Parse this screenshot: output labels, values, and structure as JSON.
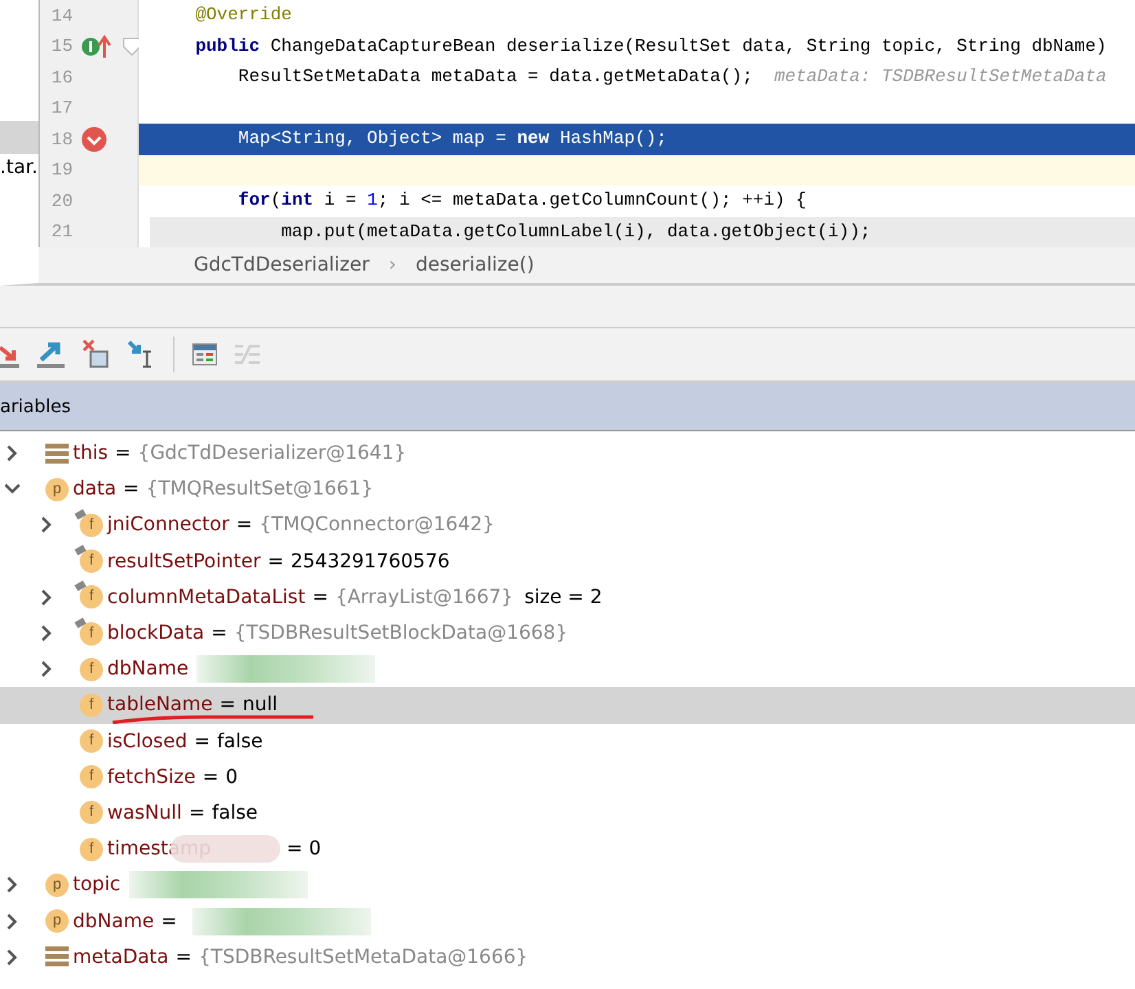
{
  "project_fragment": {
    "text": ".tar."
  },
  "code_lines": [
    {
      "number": "14",
      "breakpoint": false,
      "override": false,
      "execution": false,
      "caret": false,
      "folded": false,
      "tokens": [
        {
          "kind": "annotation",
          "text": "    @Override"
        }
      ]
    },
    {
      "number": "15",
      "breakpoint": false,
      "override": true,
      "execution": false,
      "caret": false,
      "folded": false,
      "tokens": [
        {
          "kind": "keyword",
          "text": "    public"
        },
        {
          "kind": "plain",
          "text": " ChangeDataCaptureBean deserialize(ResultSet data, String topic, String dbName)"
        }
      ]
    },
    {
      "number": "16",
      "breakpoint": false,
      "override": false,
      "execution": false,
      "caret": false,
      "folded": false,
      "tokens": [
        {
          "kind": "plain",
          "text": "        ResultSetMetaData metaData = data.getMetaData();"
        },
        {
          "kind": "hint",
          "text": "  metaData: TSDBResultSetMetaData"
        }
      ]
    },
    {
      "number": "17",
      "breakpoint": false,
      "override": false,
      "execution": false,
      "caret": false,
      "folded": false
    },
    {
      "number": "18",
      "breakpoint": true,
      "override": false,
      "execution": true,
      "caret": false,
      "folded": false,
      "tokens": [
        {
          "kind": "plain",
          "text": "        Map<String, Object> map = "
        },
        {
          "kind": "keyword",
          "text": "new"
        },
        {
          "kind": "plain",
          "text": " HashMap();"
        }
      ]
    },
    {
      "number": "19",
      "breakpoint": false,
      "override": false,
      "execution": false,
      "caret": true,
      "folded": false
    },
    {
      "number": "20",
      "breakpoint": false,
      "override": false,
      "execution": false,
      "caret": false,
      "folded": false,
      "tokens": [
        {
          "kind": "keyword",
          "text": "        for"
        },
        {
          "kind": "plain",
          "text": "("
        },
        {
          "kind": "keyword",
          "text": "int"
        },
        {
          "kind": "plain",
          "text": " i = "
        },
        {
          "kind": "number",
          "text": "1"
        },
        {
          "kind": "plain",
          "text": "; i <= metaData.getColumnCount(); ++i) {"
        }
      ]
    },
    {
      "number": "21",
      "breakpoint": false,
      "override": false,
      "execution": false,
      "caret": false,
      "folded": true,
      "tokens": [
        {
          "kind": "plain",
          "text": "            map.put(metaData.getColumnLabel(i), data.getObject(i));"
        }
      ]
    }
  ],
  "breadcrumbs": [
    "GdcTdDeserializer",
    "deserialize()"
  ],
  "breadcrumb_separator": "›",
  "toolbar_buttons": [
    {
      "kind": "step-out",
      "disabled": false
    },
    {
      "kind": "run-to-cursor",
      "disabled": false
    },
    {
      "kind": "drop-frame",
      "disabled": false
    },
    {
      "kind": "evaluate",
      "disabled": false
    },
    {
      "kind": "table",
      "disabled": false
    },
    {
      "kind": "trace",
      "disabled": true
    }
  ],
  "panel_title": "ariables",
  "variables": [
    {
      "name": "this",
      "kind": "object",
      "expanded": false,
      "selected": false,
      "eq": "=",
      "value": "{GdcTdDeserializer@1641}",
      "reference": true
    },
    {
      "name": "data",
      "kind": "param",
      "icon_letter": "p",
      "expanded": true,
      "selected": false,
      "eq": "=",
      "value": "{TMQResultSet@1661}",
      "reference": true,
      "children": [
        {
          "name": "jniConnector",
          "kind": "field",
          "icon_letter": "f",
          "overlay": true,
          "expandable": true,
          "selected": false,
          "eq": "=",
          "value": "{TMQConnector@1642}",
          "reference": true
        },
        {
          "name": "resultSetPointer",
          "kind": "field",
          "icon_letter": "f",
          "overlay": true,
          "expandable": false,
          "selected": false,
          "eq": "=",
          "value": "2543291760576",
          "reference": false
        },
        {
          "name": "columnMetaDataList",
          "kind": "field",
          "icon_letter": "f",
          "overlay": true,
          "expandable": true,
          "selected": false,
          "eq": "=",
          "value": "{ArrayList@1667}",
          "reference": true,
          "extra": "size = 2"
        },
        {
          "name": "blockData",
          "kind": "field",
          "icon_letter": "f",
          "overlay": true,
          "expandable": true,
          "selected": false,
          "eq": "=",
          "value": "{TSDBResultSetBlockData@1668}",
          "reference": true
        },
        {
          "name": "dbName",
          "kind": "field",
          "icon_letter": "f",
          "overlay": false,
          "expandable": true,
          "selected": false,
          "redacted": true
        },
        {
          "name": "tableName",
          "kind": "field",
          "icon_letter": "f",
          "overlay": false,
          "expandable": false,
          "selected": true,
          "eq": "=",
          "value": "null",
          "reference": false,
          "underlined": true
        },
        {
          "name": "isClosed",
          "kind": "field",
          "icon_letter": "f",
          "overlay": false,
          "expandable": false,
          "selected": false,
          "eq": "=",
          "value": "false",
          "reference": false
        },
        {
          "name": "fetchSize",
          "kind": "field",
          "icon_letter": "f",
          "overlay": false,
          "expandable": false,
          "selected": false,
          "eq": "=",
          "value": "0",
          "reference": false
        },
        {
          "name": "wasNull",
          "kind": "field",
          "icon_letter": "f",
          "overlay": false,
          "expandable": false,
          "selected": false,
          "eq": "=",
          "value": "false",
          "reference": false
        },
        {
          "name": "timestamp",
          "kind": "field",
          "icon_letter": "f",
          "overlay": false,
          "expandable": false,
          "selected": false,
          "eq": "= 0",
          "smudged": true
        }
      ]
    },
    {
      "name": "topic",
      "kind": "param",
      "icon_letter": "p",
      "expanded": false,
      "selected": false,
      "redacted": true
    },
    {
      "name": "dbName",
      "kind": "param",
      "icon_letter": "p",
      "expanded": false,
      "selected": false,
      "eq": "=",
      "redacted": true
    },
    {
      "name": "metaData",
      "kind": "object",
      "expanded": false,
      "selected": false,
      "eq": "=",
      "value": "{TSDBResultSetMetaData@1666}",
      "reference": true
    }
  ]
}
